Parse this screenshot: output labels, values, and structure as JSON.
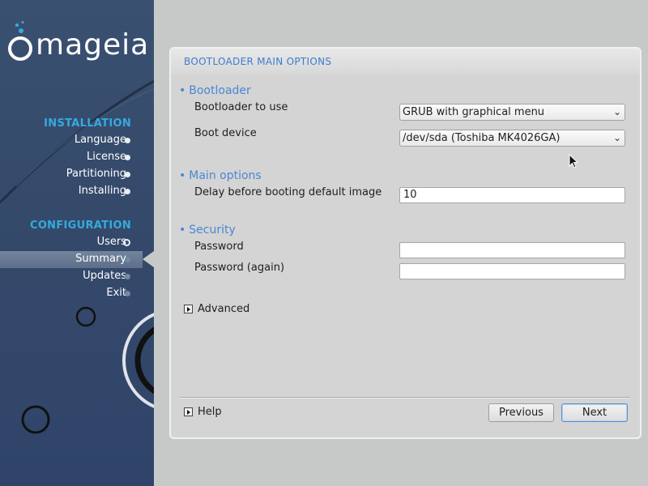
{
  "sidebar": {
    "logo_text": "mageia",
    "installation_title": "INSTALLATION",
    "installation_steps": [
      "Language",
      "License",
      "Partitioning",
      "Installing"
    ],
    "configuration_title": "CONFIGURATION",
    "configuration_steps": [
      "Users",
      "Summary",
      "Updates",
      "Exit"
    ],
    "active_step": "Summary"
  },
  "panel": {
    "title": "BOOTLOADER MAIN OPTIONS",
    "bootloader_group": "Bootloader",
    "bootloader_to_use_label": "Bootloader to use",
    "bootloader_to_use_value": "GRUB with graphical menu",
    "boot_device_label": "Boot device",
    "boot_device_value": "/dev/sda (Toshiba MK4026GA)",
    "main_options_group": "Main options",
    "delay_label": "Delay before booting default image",
    "delay_value": "10",
    "security_group": "Security",
    "password_label": "Password",
    "password_value": "",
    "password_again_label": "Password (again)",
    "password_again_value": "",
    "advanced_label": "Advanced",
    "help_label": "Help",
    "previous_label": "Previous",
    "next_label": "Next"
  },
  "colors": {
    "sidebar_bg": "#34496a",
    "section_title": "#35aadd",
    "group_title": "#4b86d6",
    "panel_bg": "#d3d4d3"
  }
}
